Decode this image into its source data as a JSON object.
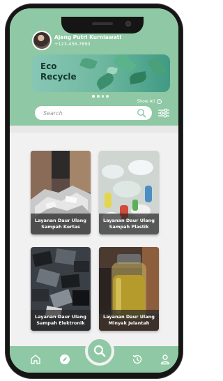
{
  "user": {
    "name": "Ajeng Putri Kurniawati",
    "phone": "+123-456-7890"
  },
  "banner": {
    "title": "Eco Recycle",
    "slide_count": 4,
    "active_slide": 1
  },
  "show_all_label": "Show All",
  "search": {
    "placeholder": "Search",
    "value": ""
  },
  "services": [
    {
      "label": "Layanan Daur Ulang Sampah Kertas",
      "photo": "paper-waste"
    },
    {
      "label": "Layanan Daur Ulang Sampah Plastik",
      "photo": "plastic-waste"
    },
    {
      "label": "Layanan Daur Ulang Sampah Elektronik",
      "photo": "electronic-waste"
    },
    {
      "label": "Layanan Daur Ulang Minyak Jelantah",
      "photo": "used-cooking-oil"
    }
  ],
  "bottom_nav": {
    "items": [
      "home-icon",
      "explore-icon",
      "search-icon",
      "history-icon",
      "profile-icon"
    ],
    "active": "search-icon"
  },
  "colors": {
    "primary": "#8fc8a4",
    "card_label_bg": "#282828"
  }
}
